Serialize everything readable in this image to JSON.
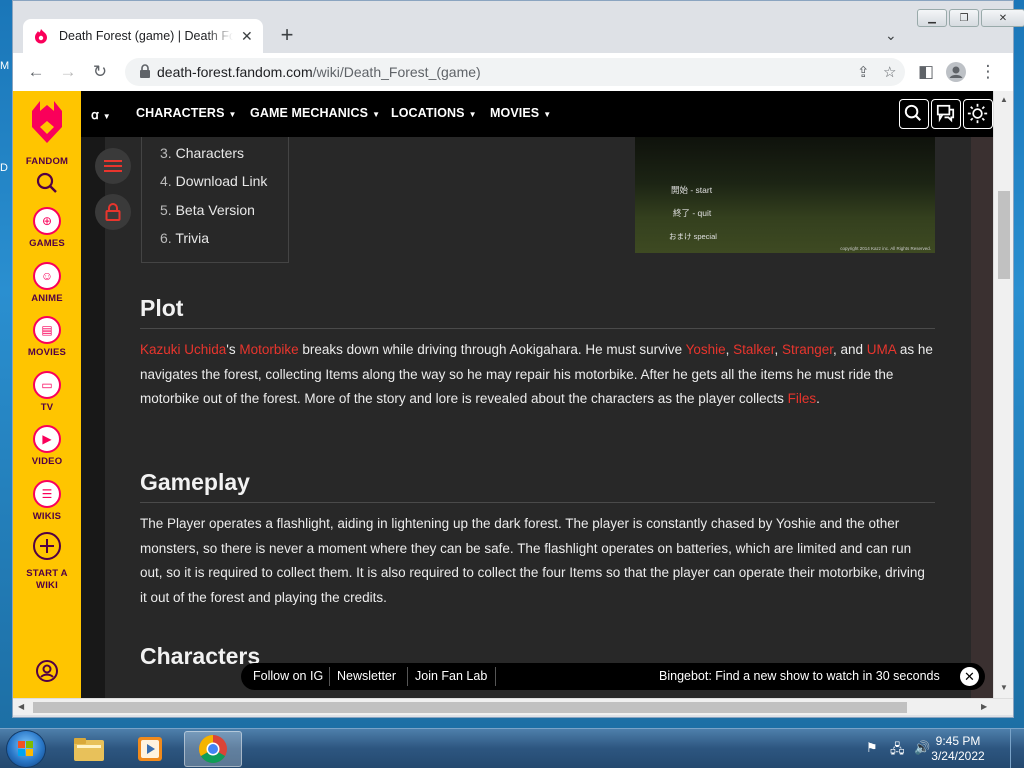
{
  "desktop": {
    "edge_text_1": "M",
    "edge_text_2": "D"
  },
  "browser": {
    "tab_title": "Death Forest (game) | Death Forest Wiki",
    "url_host": "death-forest.fandom.com",
    "url_path": "/wiki/Death_Forest_(game)"
  },
  "sidebar": {
    "brand": "FANDOM",
    "items": [
      {
        "label": "GAMES"
      },
      {
        "label": "ANIME"
      },
      {
        "label": "MOVIES"
      },
      {
        "label": "TV"
      },
      {
        "label": "VIDEO"
      },
      {
        "label": "WIKIS"
      },
      {
        "label": "START A WIKI"
      }
    ]
  },
  "topnav": {
    "items": [
      "CHARACTERS",
      "GAME MECHANICS",
      "LOCATIONS",
      "MOVIES"
    ]
  },
  "toc": [
    {
      "num": "3.",
      "label": "Characters"
    },
    {
      "num": "4.",
      "label": "Download Link"
    },
    {
      "num": "5.",
      "label": "Beta Version"
    },
    {
      "num": "6.",
      "label": "Trivia"
    }
  ],
  "hero": {
    "start": "開始 - start",
    "quit": "終了 - quit",
    "special": "おまけ special",
    "copyright": "copyright 2014 Kazz inc. All Rights Reserved."
  },
  "sections": {
    "plot": {
      "heading": "Plot",
      "link_kazuki": "Kazuki Uchida",
      "t1": "'s ",
      "link_motorbike": "Motorbike",
      "t2": " breaks down while driving through Aokigahara. He must survive ",
      "link_yoshie": "Yoshie",
      "t3": ", ",
      "link_stalker": "Stalker",
      "t4": ", ",
      "link_stranger": "Stranger",
      "t5": ", and ",
      "link_uma": "UMA",
      "t6": " as he navigates the forest, collecting Items along the way so he may repair his motorbike. After he gets all the items he must ride the motorbike out of the forest. More of the story and lore is revealed about the characters as the player collects ",
      "link_files": "Files",
      "t7": "."
    },
    "gameplay": {
      "heading": "Gameplay",
      "text": "The Player operates a flashlight, aiding in lightening up the dark forest. The player is constantly chased by Yoshie and the other monsters, so there is never a moment where they can be safe. The flashlight operates on batteries, which are limited and can run out, so it is required to collect them. It is also required to collect the four Items so that the player can operate their motorbike, driving it out of the forest and playing the credits."
    },
    "characters": {
      "heading": "Characters"
    }
  },
  "bottombar": {
    "links": [
      "Follow on IG",
      "Newsletter",
      "Join Fan Lab"
    ],
    "promo": "Bingebot: Find a new show to watch in 30 seconds"
  },
  "taskbar": {
    "time": "9:45 PM",
    "date": "3/24/2022"
  },
  "colors": {
    "fandom_yellow": "#ffc500",
    "fandom_pink": "#fa005a",
    "link_red": "#e8352d"
  }
}
